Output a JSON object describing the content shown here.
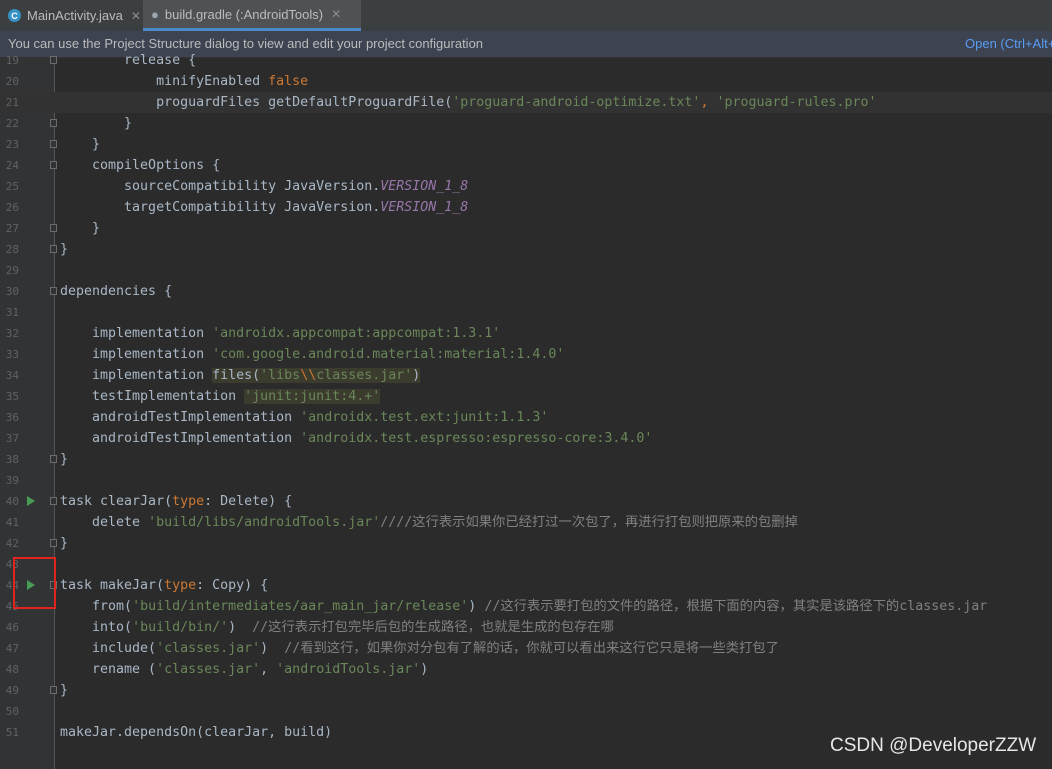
{
  "tabs": [
    {
      "label": "MainActivity.java",
      "icon": "class-c-icon",
      "active": false
    },
    {
      "label": "build.gradle (:AndroidTools)",
      "icon": "gradle-elephant-icon",
      "active": true
    }
  ],
  "tab_close": "✕",
  "banner": {
    "message": "You can use the Project Structure dialog to view and edit your project configuration",
    "link": "Open (Ctrl+Alt+"
  },
  "editor": {
    "current_line": 21,
    "lines": [
      {
        "n": 19,
        "fold": true,
        "run": false,
        "segs": [
          [
            "        release {",
            ""
          ]
        ]
      },
      {
        "n": 20,
        "fold": false,
        "run": false,
        "segs": [
          [
            "            minifyEnabled ",
            ""
          ],
          [
            "false",
            "k"
          ]
        ]
      },
      {
        "n": 21,
        "fold": false,
        "run": false,
        "segs": [
          [
            "            proguardFiles getDefaultProguardFile(",
            ""
          ],
          [
            "'proguard-android-optimize.txt'",
            "s"
          ],
          [
            ", ",
            "k"
          ],
          [
            "'proguard-rules.pro'",
            "s"
          ]
        ]
      },
      {
        "n": 22,
        "fold": true,
        "run": false,
        "segs": [
          [
            "        }",
            ""
          ]
        ]
      },
      {
        "n": 23,
        "fold": true,
        "run": false,
        "segs": [
          [
            "    }",
            ""
          ]
        ]
      },
      {
        "n": 24,
        "fold": true,
        "run": false,
        "segs": [
          [
            "    compileOptions {",
            ""
          ]
        ]
      },
      {
        "n": 25,
        "fold": false,
        "run": false,
        "segs": [
          [
            "        sourceCompatibility JavaVersion.",
            ""
          ],
          [
            "VERSION_1_8",
            "p"
          ]
        ]
      },
      {
        "n": 26,
        "fold": false,
        "run": false,
        "segs": [
          [
            "        targetCompatibility JavaVersion.",
            ""
          ],
          [
            "VERSION_1_8",
            "p"
          ]
        ]
      },
      {
        "n": 27,
        "fold": true,
        "run": false,
        "segs": [
          [
            "    }",
            ""
          ]
        ]
      },
      {
        "n": 28,
        "fold": true,
        "run": false,
        "segs": [
          [
            "}",
            ""
          ]
        ]
      },
      {
        "n": 29,
        "fold": false,
        "run": false,
        "segs": []
      },
      {
        "n": 30,
        "fold": true,
        "run": false,
        "segs": [
          [
            "dependencies {",
            ""
          ]
        ]
      },
      {
        "n": 31,
        "fold": false,
        "run": false,
        "segs": []
      },
      {
        "n": 32,
        "fold": false,
        "run": false,
        "segs": [
          [
            "    implementation ",
            ""
          ],
          [
            "'androidx.appcompat:appcompat:1.3.1'",
            "s"
          ]
        ]
      },
      {
        "n": 33,
        "fold": false,
        "run": false,
        "segs": [
          [
            "    implementation ",
            ""
          ],
          [
            "'com.google.android.material:material:1.4.0'",
            "s"
          ]
        ]
      },
      {
        "n": 34,
        "fold": false,
        "run": false,
        "segs": [
          [
            "    implementation ",
            ""
          ],
          [
            "files(",
            "hl"
          ],
          [
            "'libs",
            "s hl"
          ],
          [
            "\\\\",
            "esc hl"
          ],
          [
            "classes.jar'",
            "s hl"
          ],
          [
            ")",
            "hl"
          ]
        ]
      },
      {
        "n": 35,
        "fold": false,
        "run": false,
        "segs": [
          [
            "    testImplementation ",
            ""
          ],
          [
            "'junit:junit:4.+'",
            "s hl"
          ]
        ]
      },
      {
        "n": 36,
        "fold": false,
        "run": false,
        "segs": [
          [
            "    androidTestImplementation ",
            ""
          ],
          [
            "'androidx.test.ext:junit:1.1.3'",
            "s"
          ]
        ]
      },
      {
        "n": 37,
        "fold": false,
        "run": false,
        "segs": [
          [
            "    androidTestImplementation ",
            ""
          ],
          [
            "'androidx.test.espresso:espresso-core:3.4.0'",
            "s"
          ]
        ]
      },
      {
        "n": 38,
        "fold": true,
        "run": false,
        "segs": [
          [
            "}",
            ""
          ]
        ]
      },
      {
        "n": 39,
        "fold": false,
        "run": false,
        "segs": []
      },
      {
        "n": 40,
        "fold": true,
        "run": true,
        "segs": [
          [
            "task clearJar(",
            ""
          ],
          [
            "type",
            "k"
          ],
          [
            ": Delete) {",
            ""
          ]
        ]
      },
      {
        "n": 41,
        "fold": false,
        "run": false,
        "segs": [
          [
            "    delete ",
            ""
          ],
          [
            "'build/libs/androidTools.jar'",
            "s"
          ],
          [
            "////这行表示如果你已经打过一次包了，再进行打包则把原来的包删掉",
            "c"
          ]
        ]
      },
      {
        "n": 42,
        "fold": true,
        "run": false,
        "segs": [
          [
            "}",
            ""
          ]
        ]
      },
      {
        "n": 43,
        "fold": false,
        "run": false,
        "segs": []
      },
      {
        "n": 44,
        "fold": true,
        "run": true,
        "segs": [
          [
            "task makeJar(",
            ""
          ],
          [
            "type",
            "k"
          ],
          [
            ": Copy) {",
            ""
          ]
        ]
      },
      {
        "n": 45,
        "fold": false,
        "run": false,
        "segs": [
          [
            "    from(",
            ""
          ],
          [
            "'build/intermediates/aar_main_jar/release'",
            "s"
          ],
          [
            ") ",
            ""
          ],
          [
            "//这行表示要打包的文件的路径，根据下面的内容，其实是该路径下的classes.jar",
            "c"
          ]
        ]
      },
      {
        "n": 46,
        "fold": false,
        "run": false,
        "segs": [
          [
            "    into(",
            ""
          ],
          [
            "'build/bin/'",
            "s"
          ],
          [
            ")  ",
            ""
          ],
          [
            "//这行表示打包完毕后包的生成路径，也就是生成的包存在哪",
            "c"
          ]
        ]
      },
      {
        "n": 47,
        "fold": false,
        "run": false,
        "segs": [
          [
            "    include(",
            ""
          ],
          [
            "'classes.jar'",
            "s"
          ],
          [
            ")  ",
            ""
          ],
          [
            "//看到这行，如果你对分包有了解的话，你就可以看出来这行它只是将一些类打包了",
            "c"
          ]
        ]
      },
      {
        "n": 48,
        "fold": false,
        "run": false,
        "segs": [
          [
            "    rename (",
            ""
          ],
          [
            "'classes.jar'",
            "s"
          ],
          [
            ", ",
            ""
          ],
          [
            "'androidTools.jar'",
            "s"
          ],
          [
            ")",
            ""
          ]
        ]
      },
      {
        "n": 49,
        "fold": true,
        "run": false,
        "segs": [
          [
            "}",
            ""
          ]
        ]
      },
      {
        "n": 50,
        "fold": false,
        "run": false,
        "segs": []
      },
      {
        "n": 51,
        "fold": false,
        "run": false,
        "segs": [
          [
            "makeJar.dependsOn(clearJar, build)",
            ""
          ]
        ]
      }
    ]
  },
  "watermark": "CSDN @DeveloperZZW"
}
